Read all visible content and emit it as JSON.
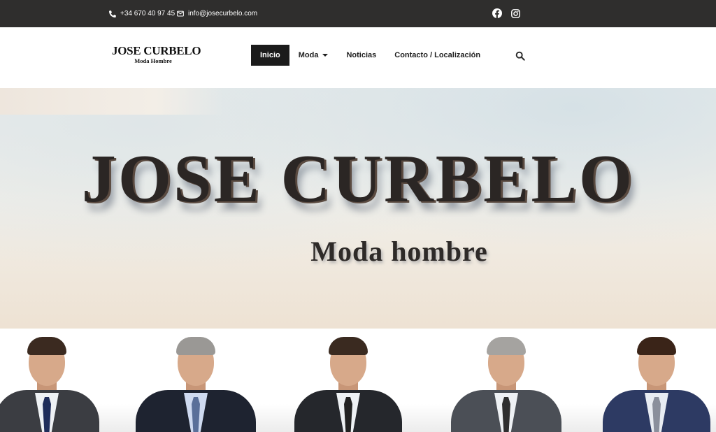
{
  "topbar": {
    "phone": "+34 670 40 97 45",
    "email": "info@josecurbelo.com",
    "social": [
      "facebook-icon",
      "instagram-icon"
    ]
  },
  "header": {
    "logo_title": "JOSE CURBELO",
    "logo_subtitle": "Moda Hombre",
    "nav": [
      {
        "label": "Inicio",
        "active": true
      },
      {
        "label": "Moda",
        "has_dropdown": true
      },
      {
        "label": "Noticias"
      },
      {
        "label": "Contacto / Localización"
      }
    ],
    "search_icon": "search-icon"
  },
  "hero": {
    "title": "JOSE CURBELO",
    "subtitle": "Moda hombre"
  },
  "colors": {
    "topbar_bg": "#2f2e2d",
    "nav_active_bg": "#1b1b1b",
    "text_dark": "#1f1f1f"
  }
}
